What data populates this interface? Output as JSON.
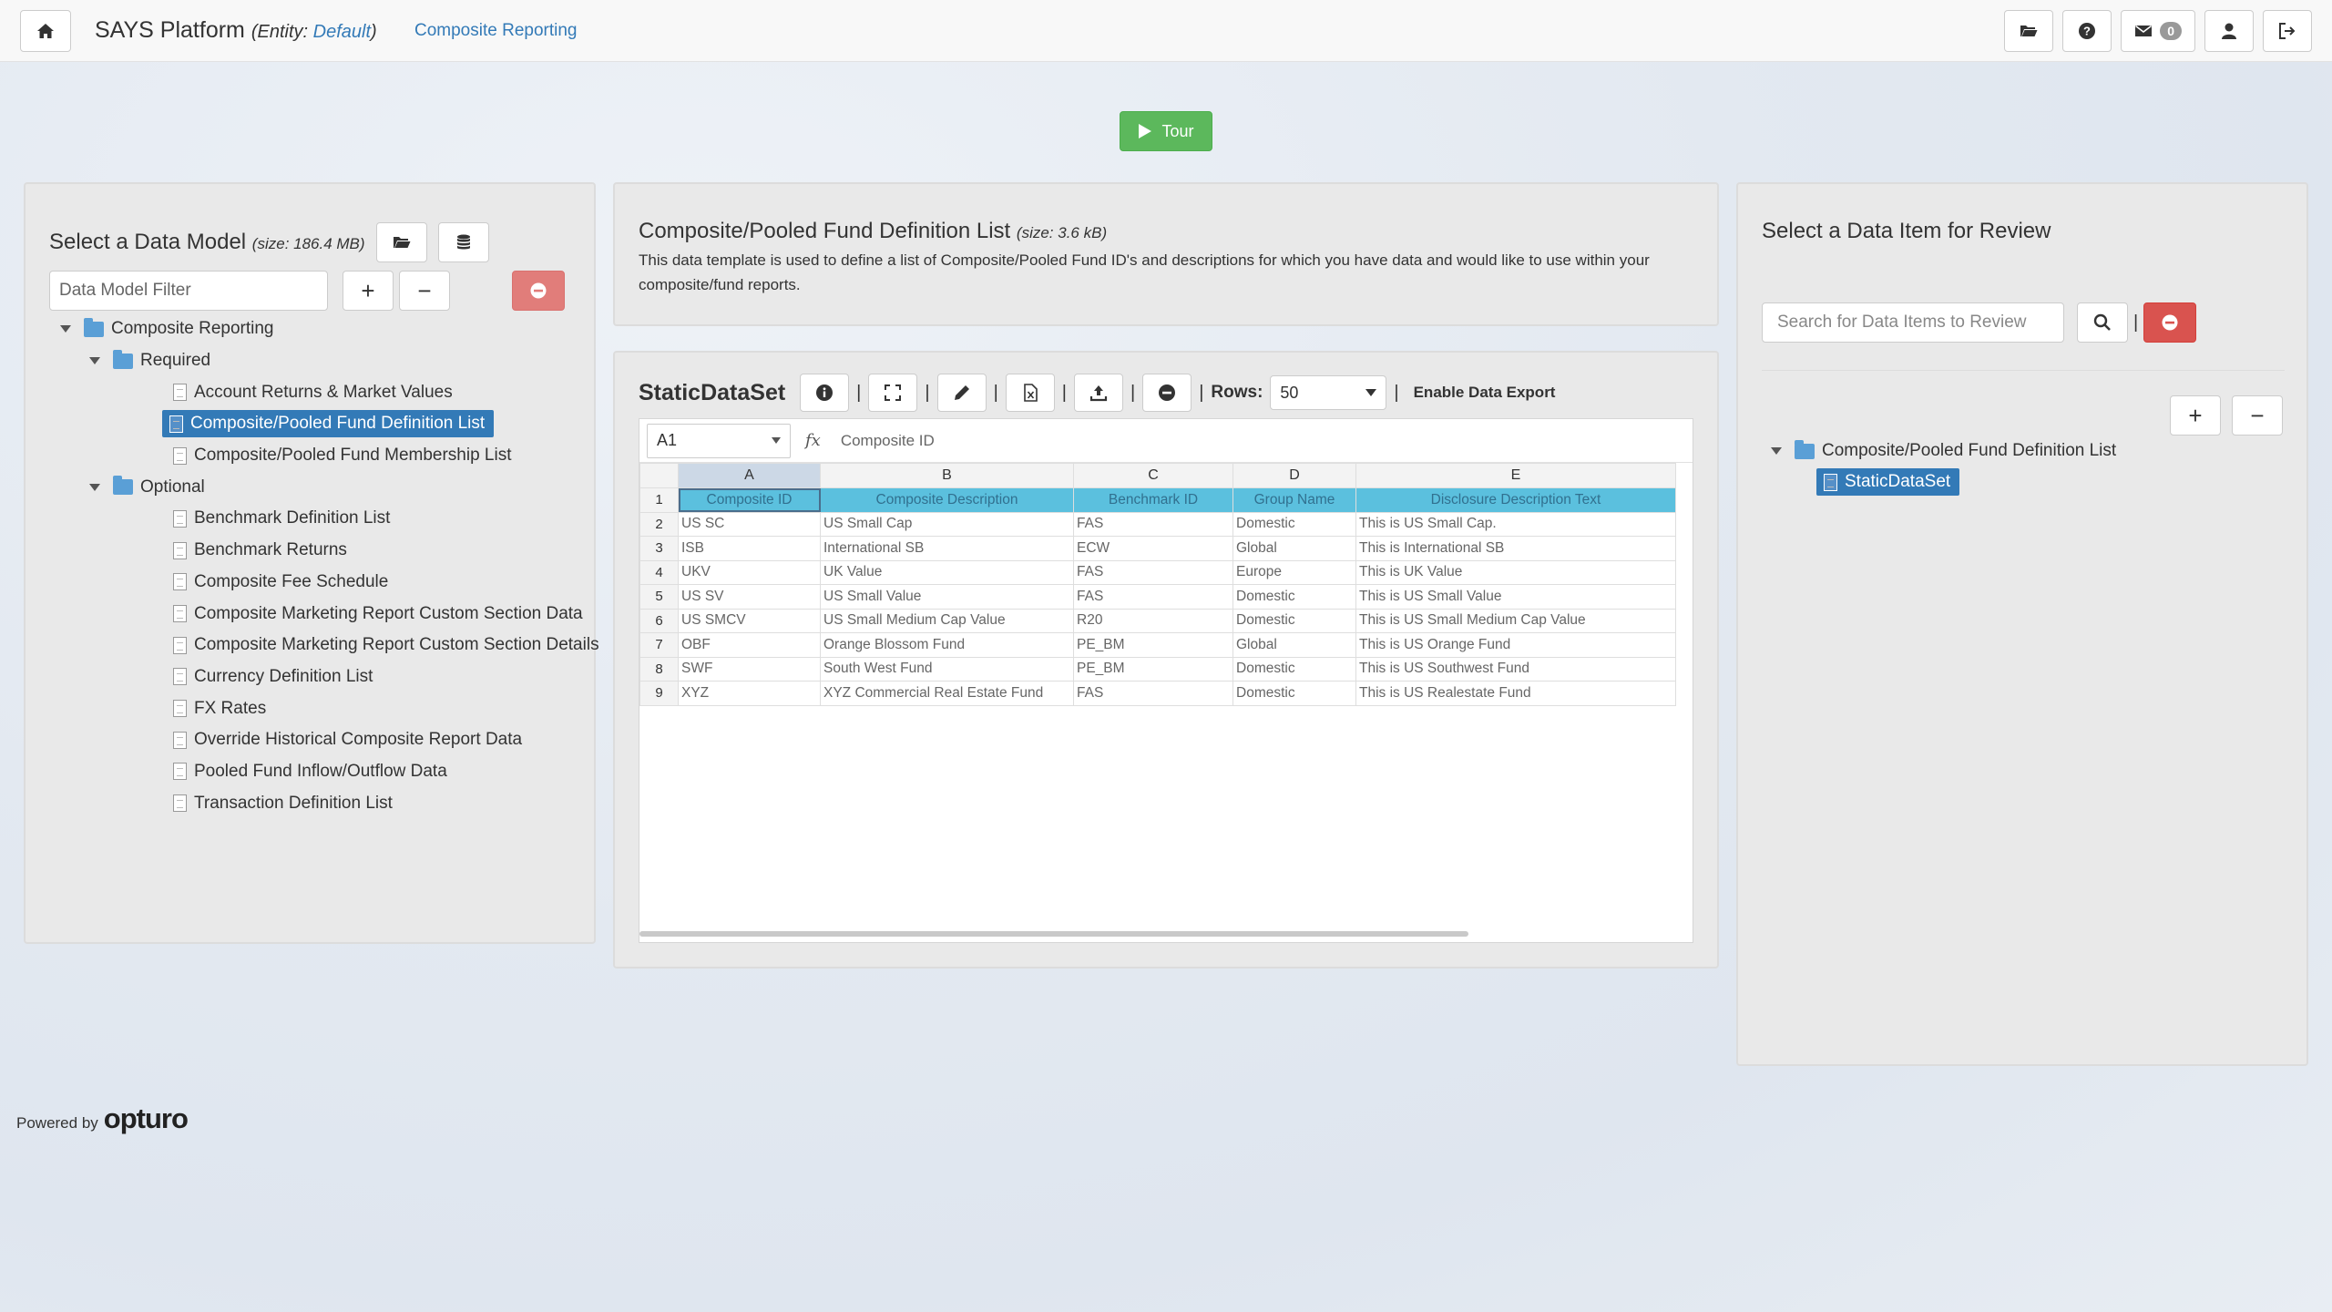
{
  "navbar": {
    "brand": "SAYS Platform",
    "entity_prefix": "(Entity: ",
    "entity_name": "Default",
    "entity_suffix": ")",
    "link": "Composite Reporting",
    "message_count": "0"
  },
  "tour": {
    "label": "Tour"
  },
  "left_panel": {
    "title": "Select a Data Model",
    "size": "(size: 186.4 MB)",
    "filter_placeholder": "Data Model Filter",
    "tree": {
      "root": "Composite Reporting",
      "required": {
        "label": "Required",
        "items": [
          "Account Returns & Market Values",
          "Composite/Pooled Fund Definition List",
          "Composite/Pooled Fund Membership List"
        ]
      },
      "optional": {
        "label": "Optional",
        "items": [
          "Benchmark Definition List",
          "Benchmark Returns",
          "Composite Fee Schedule",
          "Composite Marketing Report Custom Section Data",
          "Composite Marketing Report Custom Section Details",
          "Currency Definition List",
          "FX Rates",
          "Override Historical Composite Report Data",
          "Pooled Fund Inflow/Outflow Data",
          "Transaction Definition List"
        ]
      }
    }
  },
  "description": {
    "title": "Composite/Pooled Fund Definition List",
    "size": "(size: 3.6 kB)",
    "text": "This data template is used to define a list of Composite/Pooled Fund ID's and descriptions for which you have data and would like to use within your composite/fund reports."
  },
  "grid_panel": {
    "dataset_name": "StaticDataSet",
    "rows_label": "Rows:",
    "rows_value": "50",
    "export_label": "Enable Data Export",
    "separator": "|",
    "cell_ref": "A1",
    "fx": "fx",
    "formula_value": "Composite ID",
    "columns": [
      "A",
      "B",
      "C",
      "D",
      "E"
    ],
    "rows": [
      {
        "n": "1",
        "cells": [
          "Composite ID",
          "Composite Description",
          "Benchmark ID",
          "Group Name",
          "Disclosure Description Text"
        ]
      },
      {
        "n": "2",
        "cells": [
          "US SC",
          "US Small Cap",
          "FAS",
          "Domestic",
          "This is US Small Cap."
        ]
      },
      {
        "n": "3",
        "cells": [
          "ISB",
          "International SB",
          "ECW",
          "Global",
          "This is International SB"
        ]
      },
      {
        "n": "4",
        "cells": [
          "UKV",
          "UK Value",
          "FAS",
          "Europe",
          "This is UK Value"
        ]
      },
      {
        "n": "5",
        "cells": [
          "US SV",
          "US Small Value",
          "FAS",
          "Domestic",
          "This is US Small Value"
        ]
      },
      {
        "n": "6",
        "cells": [
          "US SMCV",
          "US Small Medium Cap Value",
          "R20",
          "Domestic",
          "This is US Small Medium Cap Value"
        ]
      },
      {
        "n": "7",
        "cells": [
          "OBF",
          "Orange Blossom Fund",
          "PE_BM",
          "Global",
          "This is US Orange Fund"
        ]
      },
      {
        "n": "8",
        "cells": [
          "SWF",
          "South West Fund",
          "PE_BM",
          "Domestic",
          "This is US Southwest Fund"
        ]
      },
      {
        "n": "9",
        "cells": [
          "XYZ",
          "XYZ Commercial Real Estate Fund",
          "FAS",
          "Domestic",
          "This is US Realestate Fund"
        ]
      }
    ]
  },
  "right_panel": {
    "title": "Select a Data Item for Review",
    "search_placeholder": "Search for Data Items to Review",
    "separator": "|",
    "tree": {
      "root": "Composite/Pooled Fund Definition List",
      "child": "StaticDataSet"
    }
  },
  "footer": {
    "powered_by": "Powered by",
    "logo": "opturo"
  },
  "colors": {
    "primary": "#337ab7",
    "success": "#5cb85c",
    "danger": "#d9534f",
    "header_row": "#5bc0de"
  }
}
